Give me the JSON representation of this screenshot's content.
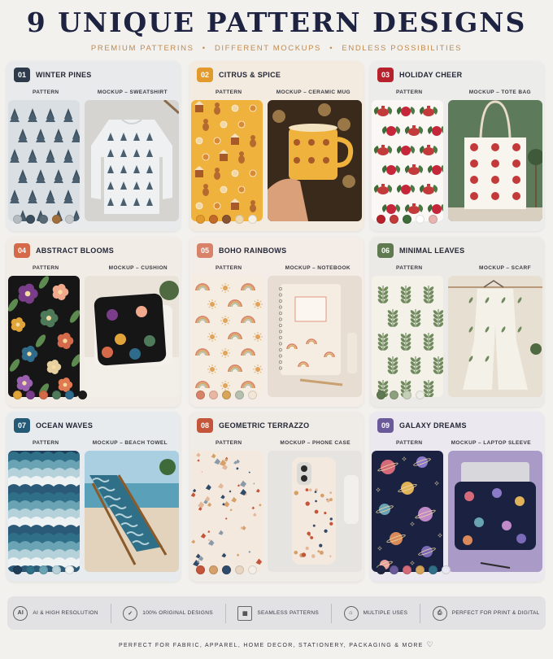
{
  "header": {
    "title": "9 UNIQUE PATTERN DESIGNS",
    "subtitle_parts": [
      "PREMIUM PATTERINS",
      "DIFFERENT MOCKUPS",
      "ENDLESS POSSIBILITIES"
    ],
    "separator": "•"
  },
  "labels": {
    "pattern": "PATTERN"
  },
  "cards": [
    {
      "num": "01",
      "title": "WINTER PINES",
      "mockup_label": "MOCKUP – SWEATSHIRT",
      "badge_color": "#2f3b4a",
      "bg": "#e9eaec",
      "pattern_icon": "pine-tree-icon",
      "mockup_icon": "sweatshirt-icon",
      "swatches": [
        "#b5bcc2",
        "#3c4f5e",
        "#5a6b76",
        "#a0703c",
        "#c7c9cc"
      ]
    },
    {
      "num": "02",
      "title": "CITRUS & SPICE",
      "mockup_label": "MOCKUP – CERAMIC MUG",
      "badge_color": "#e39a2c",
      "bg": "#f4ebe0",
      "pattern_icon": "gingerbread-icon",
      "mockup_icon": "mug-icon",
      "swatches": [
        "#e39a2c",
        "#c26a2a",
        "#8a5330",
        "#f0d9b0",
        "#f6f0e6"
      ]
    },
    {
      "num": "03",
      "title": "HOLIDAY CHEER",
      "mockup_label": "MOCKUP – TOTE BAG",
      "badge_color": "#b5222c",
      "bg": "#ececeb",
      "pattern_icon": "teapot-holly-icon",
      "mockup_icon": "tote-bag-icon",
      "swatches": [
        "#b5222c",
        "#c23a3a",
        "#3d6b3a",
        "#ffffff",
        "#e8b4b0"
      ]
    },
    {
      "num": "04",
      "title": "ABSTRACT BLOOMS",
      "mockup_label": "MOCKUP – CUSHION",
      "badge_color": "#d46a4a",
      "bg": "#f2ece6",
      "pattern_icon": "flower-icon",
      "mockup_icon": "cushion-icon",
      "swatches": [
        "#e0a43a",
        "#7a3d8a",
        "#d46a4a",
        "#4f7a5a",
        "#2f6b8a",
        "#1b1b1b"
      ]
    },
    {
      "num": "05",
      "title": "BOHO RAINBOWS",
      "mockup_label": "MOCKUP – NOTEBOOK",
      "badge_color": "#d9826a",
      "bg": "#f4ece7",
      "pattern_icon": "rainbow-icon",
      "mockup_icon": "notebook-icon",
      "swatches": [
        "#d9826a",
        "#e8b7a3",
        "#d6a45a",
        "#b5c0b0",
        "#f3e6d8"
      ]
    },
    {
      "num": "06",
      "title": "MINIMAL LEAVES",
      "mockup_label": "MOCKUP – SCARF",
      "badge_color": "#5f7a50",
      "bg": "#eceae6",
      "pattern_icon": "leaf-icon",
      "mockup_icon": "scarf-icon",
      "swatches": [
        "#5f7a50",
        "#8da07d",
        "#c5cfb8",
        "#efeee6"
      ]
    },
    {
      "num": "07",
      "title": "OCEAN WAVES",
      "mockup_label": "MOCKUP – BEACH TOWEL",
      "badge_color": "#245a75",
      "bg": "#e7ebee",
      "pattern_icon": "wave-icon",
      "mockup_icon": "beach-chair-icon",
      "swatches": [
        "#1f3e5a",
        "#2f7088",
        "#6aa3b4",
        "#b5d2da",
        "#eef2f2"
      ]
    },
    {
      "num": "08",
      "title": "GEOMETRIC TERRAZZO",
      "mockup_label": "MOCKUP – PHONE CASE",
      "badge_color": "#c4553a",
      "bg": "#efebe7",
      "pattern_icon": "terrazzo-icon",
      "mockup_icon": "phone-case-icon",
      "swatches": [
        "#c4553a",
        "#d6a06a",
        "#2f4a6a",
        "#e8d6c2",
        "#f4eee6"
      ]
    },
    {
      "num": "09",
      "title": "GALAXY DREAMS",
      "mockup_label": "MOCKUP – LAPTOP SLEEVE",
      "badge_color": "#6a5a9a",
      "bg": "#ebe9ef",
      "pattern_icon": "planet-icon",
      "mockup_icon": "laptop-sleeve-icon",
      "swatches": [
        "#1f2540",
        "#6a5a9a",
        "#d46a7a",
        "#d6a45a",
        "#2f7088",
        "#e8e6ef"
      ]
    }
  ],
  "features": [
    {
      "icon_text": "AI",
      "icon": "ai-icon",
      "label": "AI & HIGH RESOLUTION"
    },
    {
      "icon_text": "✓",
      "icon": "badge-check-icon",
      "label": "100% ORIGINAL DESIGNS"
    },
    {
      "icon_text": "▦",
      "icon": "grid-icon",
      "label": "SEAMLESS PATTERNS"
    },
    {
      "icon_text": "⌂",
      "icon": "tag-icon",
      "label": "MULTIPLE USES"
    },
    {
      "icon_text": "⎙",
      "icon": "printer-icon",
      "label": "PERFECT FOR PRINT & DIGITAL"
    }
  ],
  "footer": {
    "text": "PERFECT FOR FABRIC, APPAREL, HOME DECOR, STATIONERY, PACKAGING & MORE",
    "icon": "heart-icon"
  }
}
